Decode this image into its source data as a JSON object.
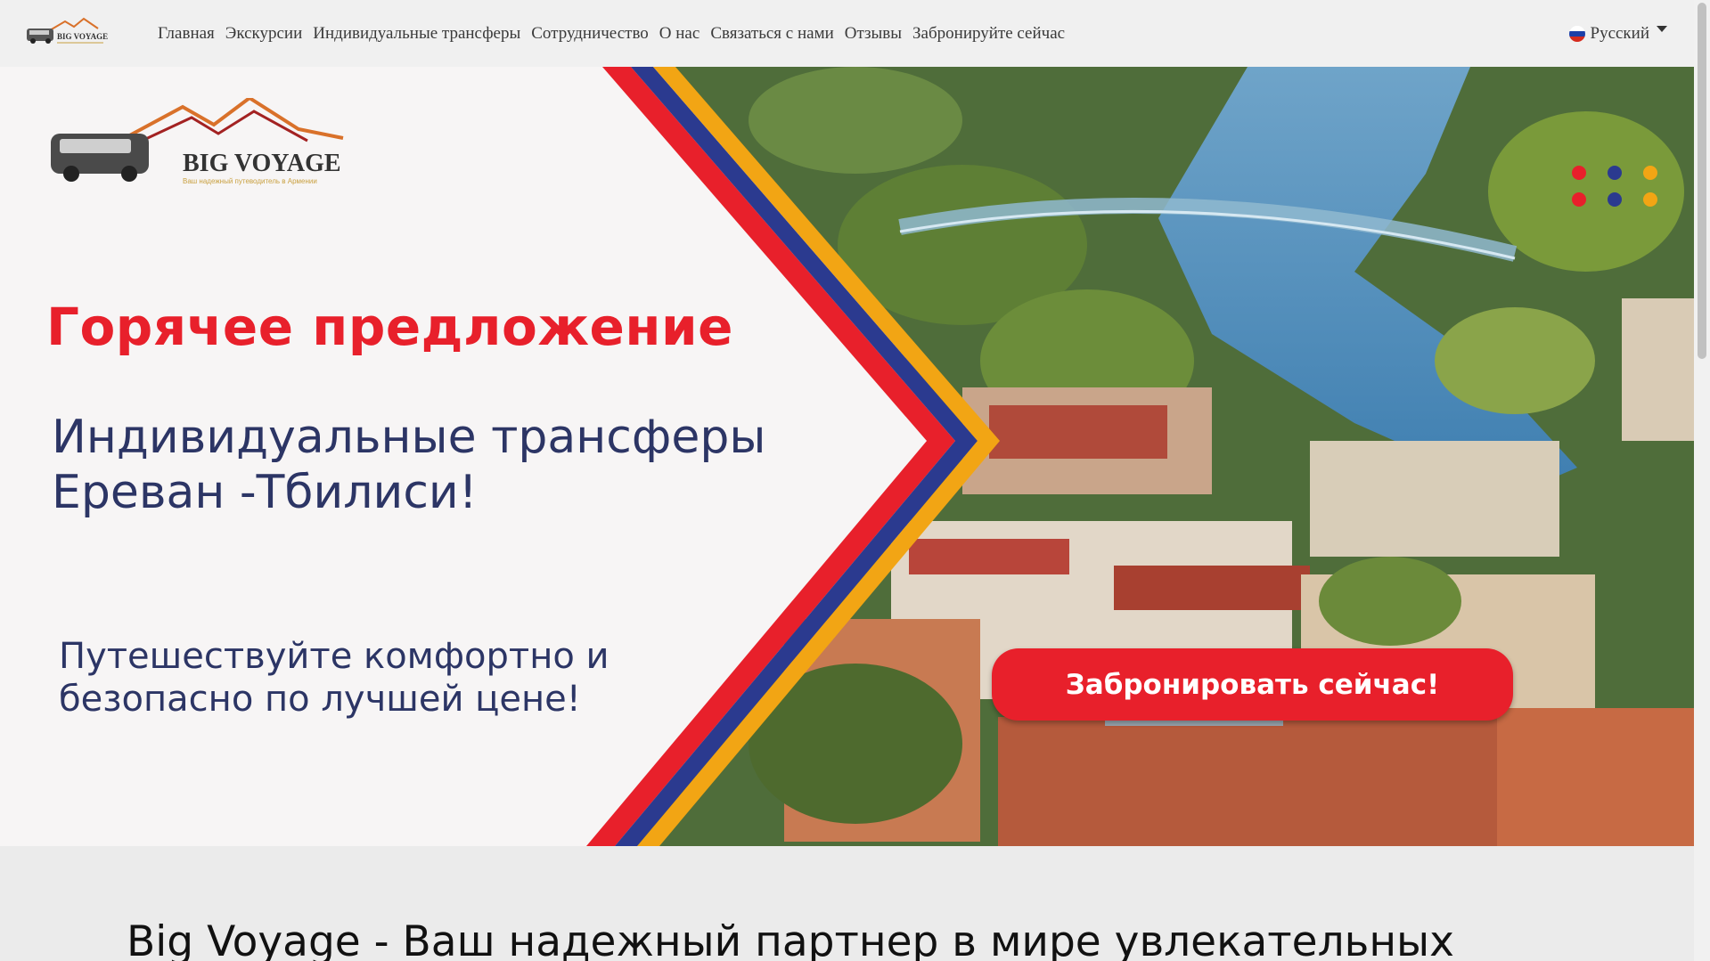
{
  "brand": {
    "name": "BIG VOYAGE",
    "tagline": "Ваш надежный путеводитель в Армении"
  },
  "nav": {
    "items": [
      {
        "label": "Главная"
      },
      {
        "label": "Экскурсии"
      },
      {
        "label": "Индивидуальные трансферы"
      },
      {
        "label": "Сотрудничество"
      },
      {
        "label": "О нас"
      },
      {
        "label": "Связаться с нами"
      },
      {
        "label": "Отзывы"
      },
      {
        "label": "Забронируйте сейчас"
      }
    ],
    "language": "Русский"
  },
  "hero": {
    "headline": "Горячее предложение",
    "subline1": "Индивидуальные трансферы",
    "subline2": "Ереван -Тбилиси!",
    "tagline1": "Путешествуйте комфортно и",
    "tagline2": "безопасно по лучшей цене!",
    "cta": "Забронировать сейчас!"
  },
  "section": {
    "heading": "Big Voyage - Ваш надежный партнер в мире увлекательных"
  },
  "colors": {
    "red": "#e8202b",
    "blue": "#2b3a8f",
    "orange": "#f2a514",
    "navy": "#2c3565"
  }
}
